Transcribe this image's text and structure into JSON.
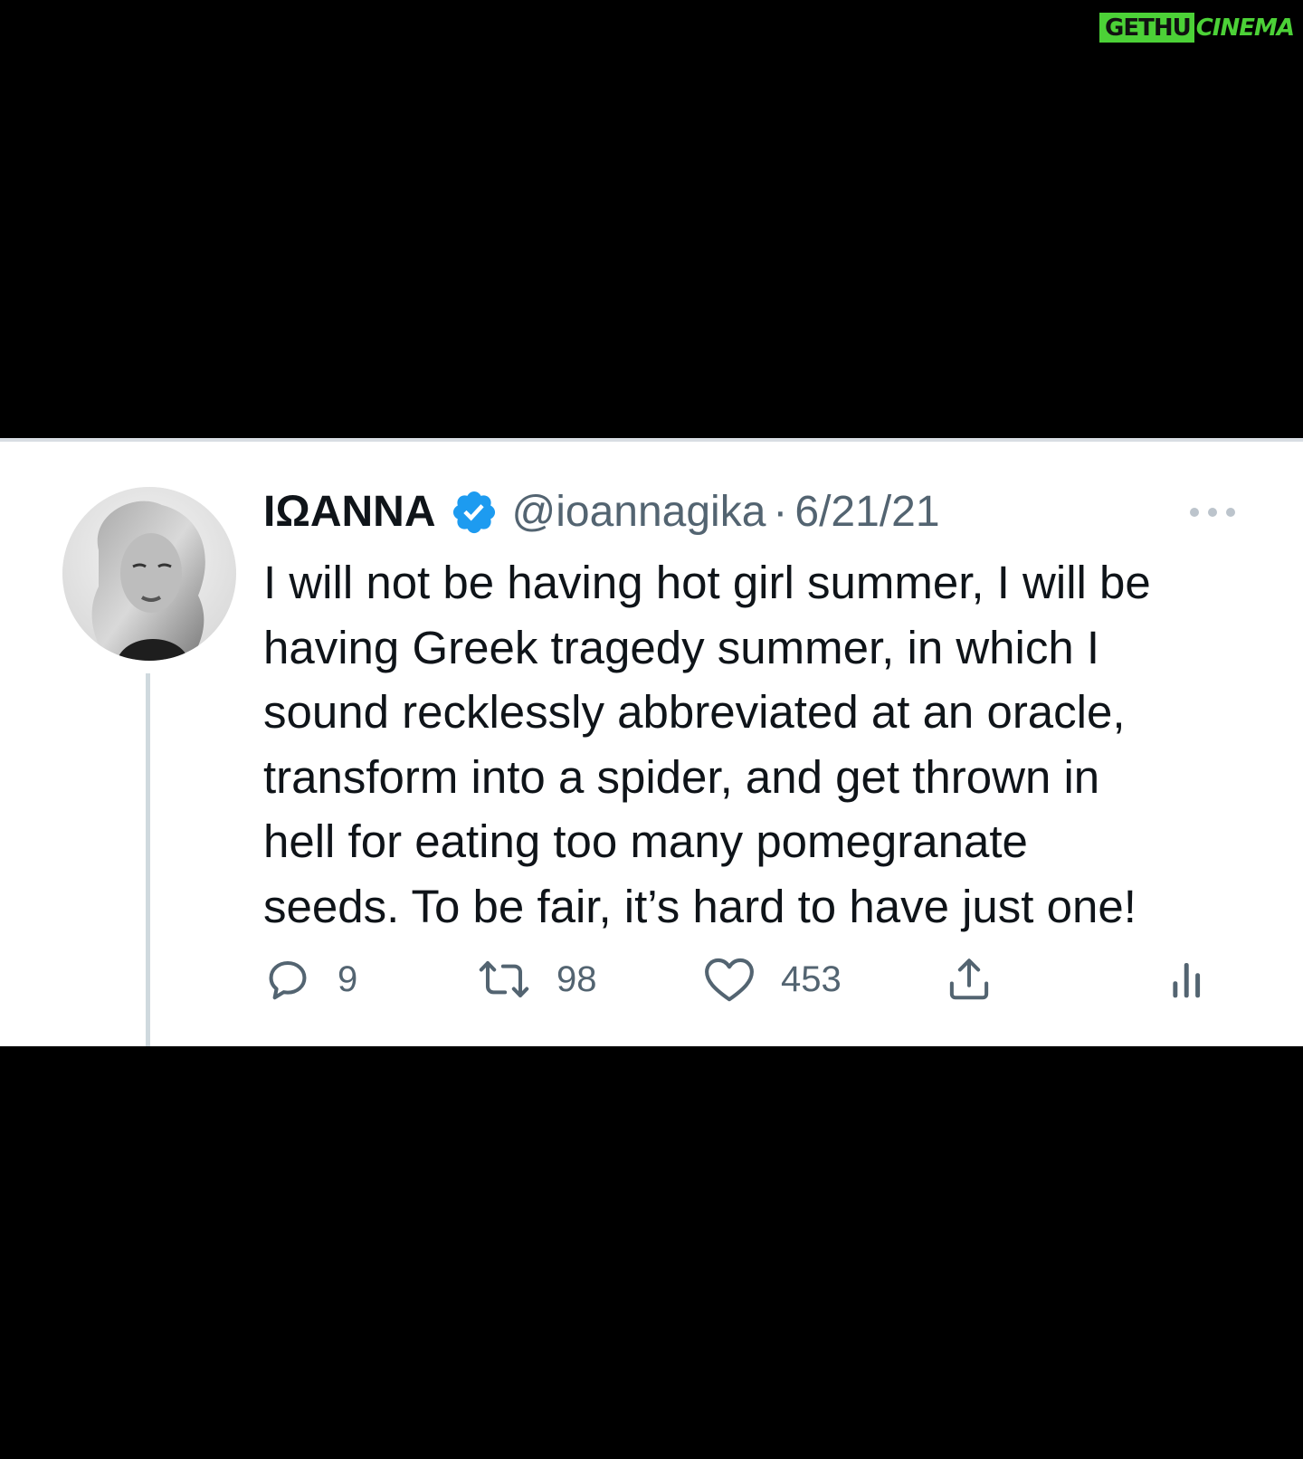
{
  "watermark": {
    "part1": "GETHU",
    "part2": "CINEMA"
  },
  "tweet": {
    "display_name": "ΙΩΑΝΝΑ",
    "handle": "@ioannagika",
    "separator": "·",
    "date": "6/21/21",
    "lines": [
      "I will not be having hot girl summer, I will be",
      "having Greek tragedy summer, in which I",
      "sound recklessly abbreviated at an oracle,",
      "transform into a spider, and get thrown in",
      "hell for eating too many pomegranate",
      "seeds. To be fair, it’s hard to have just one!"
    ],
    "replies": "9",
    "retweets": "98",
    "likes": "453"
  },
  "icons": {
    "verified": "verified-badge-icon",
    "more": "more-options-icon",
    "reply": "reply-bubble-icon",
    "retweet": "retweet-icon",
    "like": "heart-icon",
    "share": "share-icon",
    "analytics": "analytics-bars-icon"
  },
  "colors": {
    "verified_blue": "#1d9bf0",
    "secondary_text": "#536471",
    "primary_text": "#0f1419",
    "watermark_green": "#4cd137"
  }
}
